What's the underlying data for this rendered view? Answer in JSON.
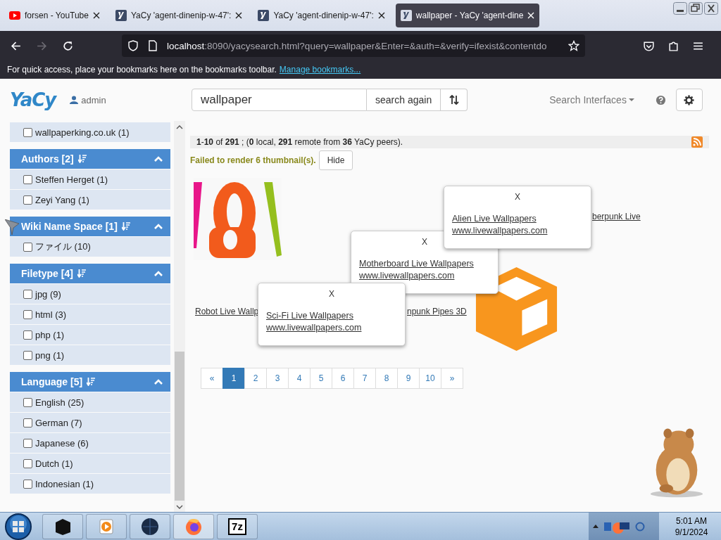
{
  "browser": {
    "tabs": [
      {
        "label": "forsen - YouTube",
        "kind": "youtube",
        "selected": false
      },
      {
        "label": "YaCy 'agent-dinenip-w-47':",
        "kind": "yacy",
        "selected": false
      },
      {
        "label": "YaCy 'agent-dinenip-w-47':",
        "kind": "yacy",
        "selected": false
      },
      {
        "label": "wallpaper - YaCy 'agent-dine",
        "kind": "yacy",
        "selected": true
      }
    ],
    "forward_disabled": true,
    "url": {
      "host": "localhost",
      "rest": ":8090/yacysearch.html?query=wallpaper&Enter=&auth=&verify=ifexist&contentdo"
    },
    "bookmarks_bar": {
      "text": "For quick access, place your bookmarks here on the bookmarks toolbar.",
      "link": "Manage bookmarks..."
    }
  },
  "header": {
    "logo": "YaCy",
    "user": "admin",
    "search_value": "wallpaper",
    "search_button": "search again",
    "interfaces": "Search Interfaces"
  },
  "sidebar": {
    "groups": [
      {
        "items": [
          {
            "label": "wallpaperking.co.uk (1)",
            "checked": false
          }
        ]
      },
      {
        "title": "Authors [2]",
        "expanded": true,
        "items": [
          {
            "label": "Steffen Herget (1)",
            "checked": false
          },
          {
            "label": "Zeyi Yang (1)",
            "checked": false
          }
        ]
      },
      {
        "title": "Wiki Name Space [1]",
        "expanded": true,
        "items": [
          {
            "label": "ファイル (10)",
            "checked": false
          }
        ]
      },
      {
        "title": "Filetype [4]",
        "expanded": true,
        "items": [
          {
            "label": "jpg (9)",
            "checked": false
          },
          {
            "label": "html (3)",
            "checked": false
          },
          {
            "label": "php (1)",
            "checked": false
          },
          {
            "label": "png (1)",
            "checked": false
          }
        ]
      },
      {
        "title": "Language [5]",
        "expanded": true,
        "items": [
          {
            "label": "English (25)",
            "checked": false
          },
          {
            "label": "German (7)",
            "checked": false
          },
          {
            "label": "Japanese (6)",
            "checked": false
          },
          {
            "label": "Dutch (1)",
            "checked": false
          },
          {
            "label": "Indonesian (1)",
            "checked": false
          }
        ]
      }
    ]
  },
  "results": {
    "summary": "**1**-**10** of **291** ; (**0** local, **291** remote from **36** YaCy peers).",
    "warning": "Failed to render 6 thumbnail(s).",
    "hide_button": "Hide",
    "links": [
      "berpunk Live",
      "Robot Live Wallp",
      "npunk Pipes 3D"
    ],
    "popups": [
      {
        "close": "X",
        "title": "Alien Live Wallpapers",
        "url": "www.livewallpapers.com"
      },
      {
        "close": "X",
        "title": "Motherboard Live Wallpapers",
        "url": "www.livewallpapers.com"
      },
      {
        "close": "X",
        "title": "Sci-Fi Live Wallpapers",
        "url": "www.livewallpapers.com"
      }
    ]
  },
  "pagination": [
    {
      "label": "«",
      "selected": false
    },
    {
      "label": "1",
      "selected": true
    },
    {
      "label": "2",
      "selected": false
    },
    {
      "label": "3",
      "selected": false
    },
    {
      "label": "4",
      "selected": false
    },
    {
      "label": "5",
      "selected": false
    },
    {
      "label": "6",
      "selected": false
    },
    {
      "label": "7",
      "selected": false
    },
    {
      "label": "8",
      "selected": false
    },
    {
      "label": "9",
      "selected": false
    },
    {
      "label": "10",
      "selected": false
    },
    {
      "label": "»",
      "selected": false
    }
  ],
  "taskbar": {
    "apps": [
      {
        "kind": "box",
        "selected": false
      },
      {
        "kind": "media",
        "selected": false
      },
      {
        "kind": "globe",
        "selected": false
      },
      {
        "kind": "firefox",
        "selected": true
      },
      {
        "kind": "archiver",
        "label": "7z",
        "selected": false
      }
    ],
    "time": "5:01 AM",
    "date": "9/1/2024"
  }
}
